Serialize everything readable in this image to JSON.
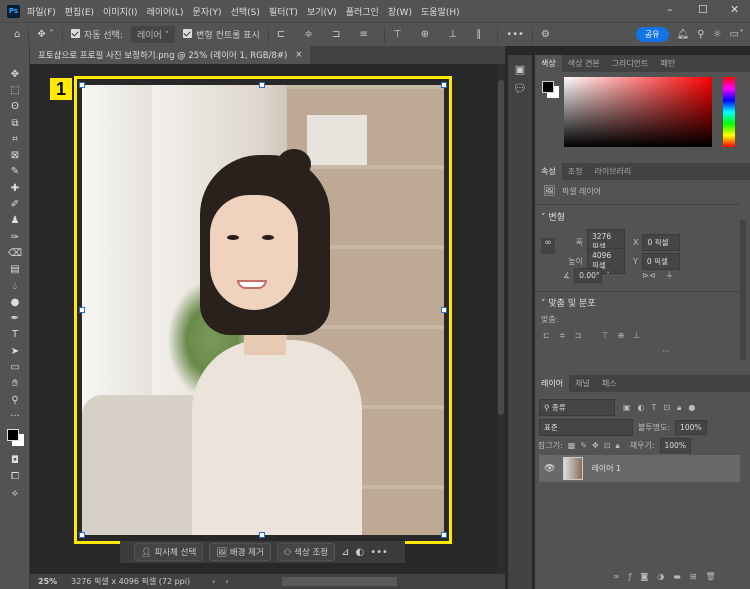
{
  "app": {
    "logo": "Ps"
  },
  "menu": [
    "파일(F)",
    "편집(E)",
    "이미지(I)",
    "레이어(L)",
    "문자(Y)",
    "선택(S)",
    "필터(T)",
    "보기(V)",
    "플러그인",
    "창(W)",
    "도움말(H)"
  ],
  "options": {
    "auto_select": "자동 선택:",
    "layer_select": "레이어",
    "show_transform": "변형 컨트롤 표시",
    "share": "공유"
  },
  "document": {
    "tab_title": "포토샵으로 프로필 사진 보정하기.png @ 25% (레이어 1, RGB/8#)",
    "close": "×",
    "badge": "1"
  },
  "status": {
    "zoom": "25%",
    "info": "3276 픽셀 x 4096 픽셀 (72 ppi)"
  },
  "floatbar": {
    "select_subject": "피사체 선택",
    "remove_bg": "배경 제거",
    "color_adjust": "색상 조정"
  },
  "color_panel": {
    "tabs": [
      "색상",
      "색상 견본",
      "그라디언트",
      "패턴"
    ]
  },
  "properties": {
    "tabs": [
      "속성",
      "조정",
      "라이브러리"
    ],
    "layer_type": "픽셀 레이어",
    "transform": "변형",
    "w_label": "폭",
    "w": "3276 픽셀",
    "h_label": "높이",
    "h": "4096 픽셀",
    "x_label": "X",
    "x": "0 픽셀",
    "y_label": "Y",
    "y": "0 픽셀",
    "angle": "0.00°",
    "align_section": "맞춤 및 분포",
    "align_label": "맞춤:",
    "more": "···"
  },
  "layers": {
    "tabs": [
      "레이어",
      "채널",
      "패스"
    ],
    "filter": "종류",
    "blend": "표준",
    "opacity_label": "불투명도:",
    "opacity": "100%",
    "lock_label": "잠그기:",
    "fill_label": "채우기:",
    "fill": "100%",
    "items": [
      {
        "name": "레이어 1",
        "visible": true
      }
    ]
  },
  "colors": {
    "accent": "#1473e6",
    "frame": "#ffea00"
  }
}
